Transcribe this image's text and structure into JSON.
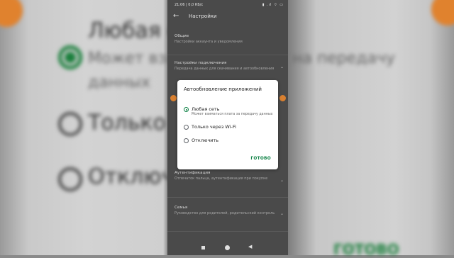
{
  "background": {
    "title": "Любая се",
    "option1_line1": "Может взим",
    "option1_line1_right": "на передачу",
    "option1_line2": "данных",
    "option2": "Только че",
    "option3": "Отключ",
    "done": "ГОТОВО"
  },
  "status_bar": {
    "time": "21:06 | 0,0 КБ/с",
    "icons": "▮ .ıl ⌔ ▭"
  },
  "header": {
    "title": "Настройки"
  },
  "settings": [
    {
      "title": "Общие",
      "subtitle": "Настройки аккаунта и уведомления"
    },
    {
      "title": "Настройки подключения",
      "subtitle": "Передача данных для скачивания и автообновления"
    },
    {
      "title": "Аутентификация",
      "subtitle": "Отпечаток пальца, аутентификация при покупке"
    },
    {
      "title": "Семья",
      "subtitle": "Руководство для родителей, родительский контроль"
    }
  ],
  "dialog": {
    "title": "Автообновление приложений",
    "options": [
      {
        "label": "Любая сеть",
        "sub": "Может взиматься плата за передачу данных",
        "selected": true
      },
      {
        "label": "Только через Wi-Fi",
        "selected": false
      },
      {
        "label": "Отключить",
        "selected": false
      }
    ],
    "done": "ГОТОВО"
  },
  "colors": {
    "accent": "#0b8043",
    "phone_bg": "#4a4a4a",
    "dialog_bg": "#ffffff"
  },
  "icons": {
    "back": "arrow-back-icon",
    "expand": "chevron-up-icon",
    "nav": [
      "recent-apps-icon",
      "home-icon",
      "back-icon"
    ]
  }
}
